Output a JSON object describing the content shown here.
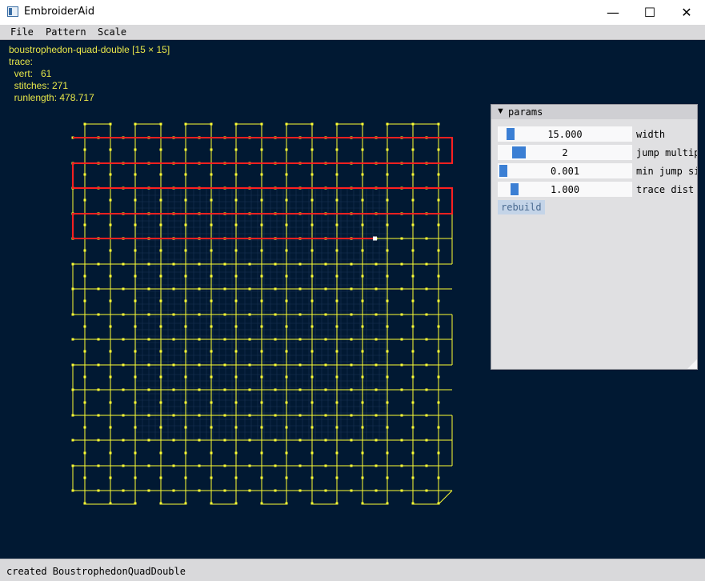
{
  "window": {
    "title": "EmbroiderAid",
    "minimize": "—",
    "maximize": "☐",
    "close": "✕",
    "icon": "app-icon"
  },
  "menu": [
    "File",
    "Pattern",
    "Scale"
  ],
  "info": {
    "pattern": "boustrophedon-quad-double [15 × 15]",
    "trace": "trace:",
    "vert": "  vert:   61",
    "stitches": "  stitches: 271",
    "runlength": "  runlength: 478.717"
  },
  "colors": {
    "background": "#011933",
    "pattern": "#ffff33",
    "trace": "#ff2020",
    "grid": "#1a3355",
    "accent": "#3b7fd4"
  },
  "params": {
    "title": "params",
    "collapse_icon": "▼",
    "rows": [
      {
        "value": "15.000",
        "label": "width",
        "level": 0.06
      },
      {
        "value": "2",
        "label": "jump multiplier",
        "level": 0.11
      },
      {
        "value": "0.001",
        "label": "min jump size",
        "level": 0.0
      },
      {
        "value": "1.000",
        "label": "trace dist",
        "level": 0.09
      }
    ],
    "rebuild_label": "rebuild"
  },
  "status": "created BoustrophedonQuadDouble"
}
